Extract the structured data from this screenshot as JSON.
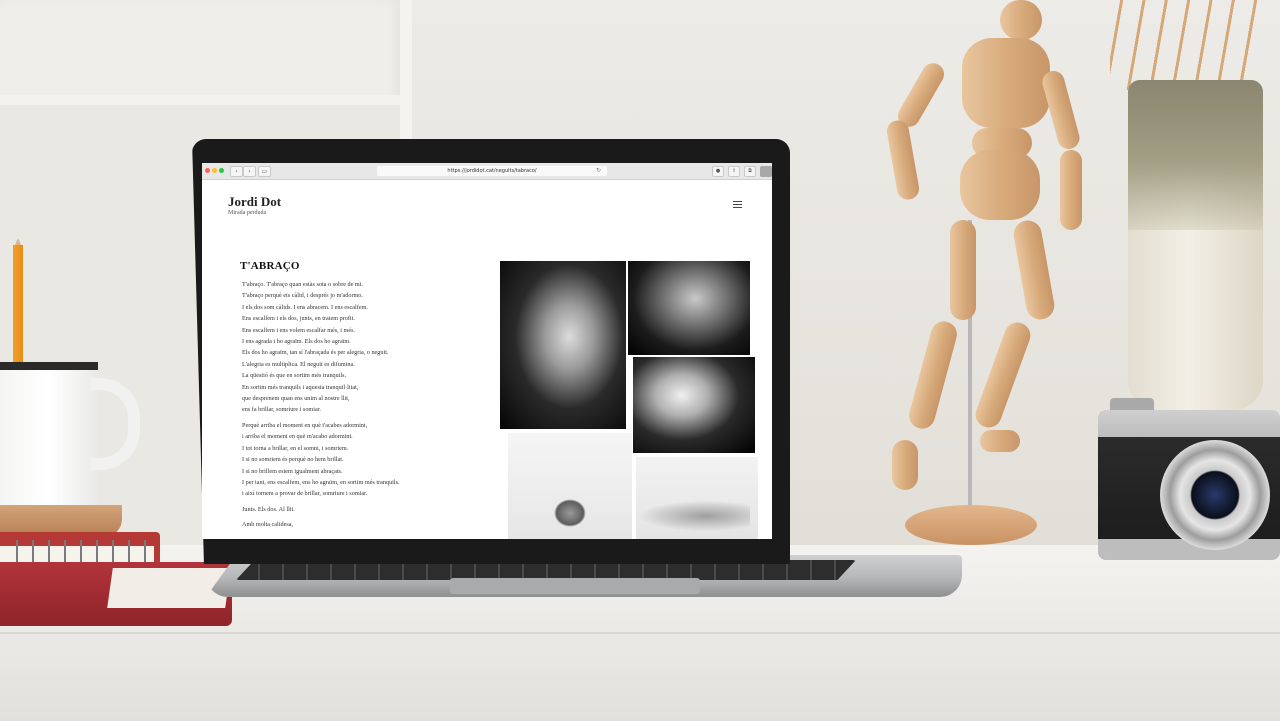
{
  "browser": {
    "url": "https://jordidot.cat/neguits/tabraco/",
    "back_icon": "chevron-left",
    "forward_icon": "chevron-right",
    "sidebar_icon": "sidebar",
    "reload_icon": "reload",
    "toolbar_icons": [
      "download",
      "share",
      "tabs"
    ],
    "traffic_light_colors": [
      "#ff5f57",
      "#febc2e",
      "#28c840"
    ]
  },
  "site": {
    "title": "Jordi Dot",
    "tagline": "Mirada perduda",
    "menu_icon": "hamburger"
  },
  "article": {
    "title": "T'ABRAÇO",
    "stanza1": [
      "T'abraço. T'abraço quan estàs sota o sobre de mi.",
      "T'abraço perquè ets càlid, i després jo m'adormo.",
      "I els dos som càlids. I ens abracem. I ens escalfem.",
      "Ens escalfem i els dos, junts, en traiem profit.",
      "Ens escalfem i ens volem escalfar més, i més.",
      "I ens agrada i ho agraïm. Els dos ho agraïm.",
      "Els dos ho agraïm, tan sí l'abraçada és per alegria, o neguit.",
      "L'alegria es multiplica. El neguit es difumina.",
      "La qüestió és que en sortim més tranquils.",
      "En sortim més tranquils i aquesta tranquil·litat,",
      "que desprenem quan ens unim al nostre llit,",
      "ens fa brillar, somriure i somiar."
    ],
    "stanza2": [
      "Perquè arriba el moment en què t'acabes adormint,",
      "i arriba el moment en què m'acabo adormint.",
      "I tot torna a brillar, en el somni, i somriem.",
      "I si no somriem és perquè no hem brillat.",
      "I si no brillem estem igualment abraçats.",
      "I per tant, ens escalfem, ens ho agraïm, en sortim més tranquils.",
      "i així tornem a provar de brillar, somriure i somiar."
    ],
    "stanza3": [
      "Junts. Els dos. Al llit."
    ],
    "signoff": "Amb molta calidesa,"
  }
}
